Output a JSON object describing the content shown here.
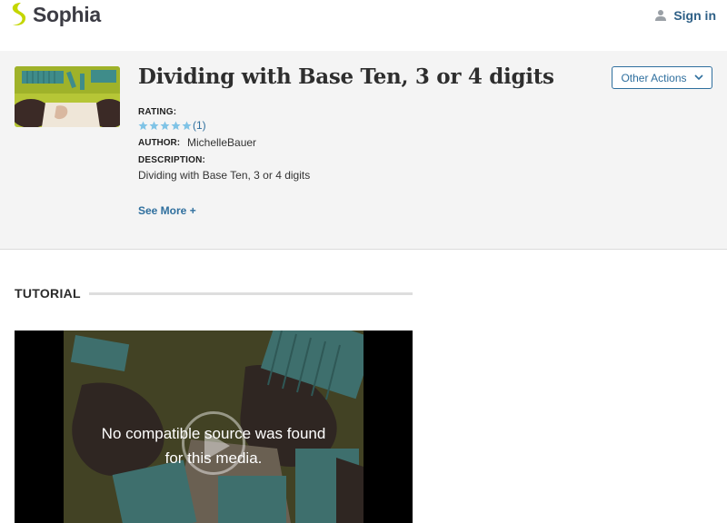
{
  "header": {
    "logo_text": "Sophia",
    "signin_label": "Sign in",
    "colors": {
      "logo_mark": "#c4d600",
      "link": "#2d5f86"
    }
  },
  "tutorial": {
    "title": "Dividing with Base Ten, 3 or 4 digits",
    "other_actions_label": "Other Actions",
    "rating_label": "RATING:",
    "rating_stars": 5,
    "rating_count": "(1)",
    "author_label": "AUTHOR:",
    "author_name": "MichelleBauer",
    "description_label": "DESCRIPTION:",
    "description_text": "Dividing with Base Ten, 3 or 4 digits",
    "see_more_label": "See More +"
  },
  "section": {
    "heading": "TUTORIAL"
  },
  "video": {
    "error_line1": "No compatible source was found",
    "error_line2": "for this media."
  },
  "icons": [
    "sophia-logo-icon",
    "user-icon",
    "chevron-down-icon",
    "star-icon",
    "play-icon"
  ]
}
